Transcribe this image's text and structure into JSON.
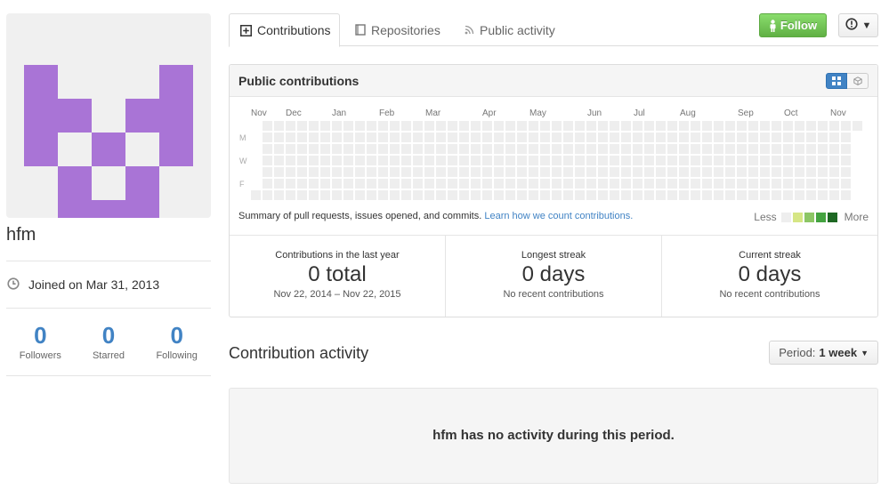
{
  "profile": {
    "username": "hfm",
    "joined": "Joined on Mar 31, 2013",
    "avatar_color": "#a974d6",
    "stats": [
      {
        "value": "0",
        "label": "Followers"
      },
      {
        "value": "0",
        "label": "Starred"
      },
      {
        "value": "0",
        "label": "Following"
      }
    ]
  },
  "tabs": [
    {
      "label": "Contributions",
      "icon": "plus-square-icon",
      "active": true
    },
    {
      "label": "Repositories",
      "icon": "repo-book-icon",
      "active": false
    },
    {
      "label": "Public activity",
      "icon": "rss-icon",
      "active": false
    }
  ],
  "actions": {
    "follow_label": "Follow",
    "more_icon": "alert-circle-icon"
  },
  "contributions": {
    "title": "Public contributions",
    "months": [
      "Nov",
      "Dec",
      "Jan",
      "Feb",
      "Mar",
      "Apr",
      "May",
      "Jun",
      "Jul",
      "Aug",
      "Sep",
      "Oct",
      "Nov"
    ],
    "day_labels": [
      "M",
      "W",
      "F"
    ],
    "summary_text": "Summary of pull requests, issues opened, and commits.",
    "summary_link": "Learn how we count contributions.",
    "legend_less": "Less",
    "legend_more": "More",
    "legend_colors": [
      "#eeeeee",
      "#d6e685",
      "#8cc665",
      "#44a340",
      "#1e6823"
    ],
    "empty_color": "#eeeeee"
  },
  "streaks": [
    {
      "title": "Contributions in the last year",
      "value": "0 total",
      "sub": "Nov 22, 2014 – Nov 22, 2015"
    },
    {
      "title": "Longest streak",
      "value": "0 days",
      "sub": "No recent contributions"
    },
    {
      "title": "Current streak",
      "value": "0 days",
      "sub": "No recent contributions"
    }
  ],
  "activity": {
    "title": "Contribution activity",
    "period_label": "Period:",
    "period_value": "1 week",
    "empty_message": "hfm has no activity during this period."
  }
}
